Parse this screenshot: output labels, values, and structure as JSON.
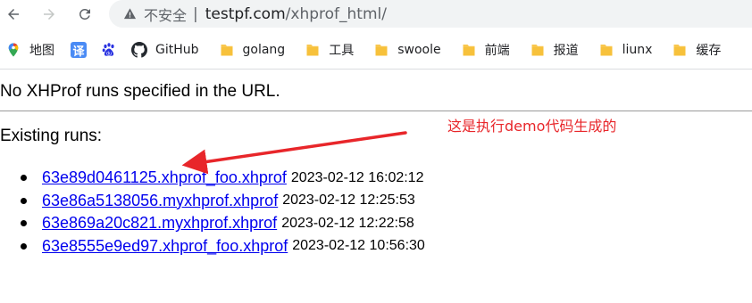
{
  "browser": {
    "security_label": "不安全",
    "separator": "|",
    "url_host": "testpf.com",
    "url_path": "/xhprof_html/"
  },
  "bookmarks": [
    {
      "label": "地图",
      "icon": "maps-icon"
    },
    {
      "label": "",
      "icon": "translate-icon",
      "glyph": "译"
    },
    {
      "label": "",
      "icon": "baidu-paw-icon"
    },
    {
      "label": "GitHub",
      "icon": "github-icon"
    },
    {
      "label": "golang",
      "icon": "folder-icon"
    },
    {
      "label": "工具",
      "icon": "folder-icon"
    },
    {
      "label": "swoole",
      "icon": "folder-icon"
    },
    {
      "label": "前端",
      "icon": "folder-icon"
    },
    {
      "label": "报道",
      "icon": "folder-icon"
    },
    {
      "label": "liunx",
      "icon": "folder-icon"
    },
    {
      "label": "缓存",
      "icon": "folder-icon"
    }
  ],
  "page": {
    "message": "No XHProf runs specified in the URL.",
    "existing_label": "Existing runs:",
    "runs": [
      {
        "file": "63e89d0461125.xhprof_foo.xhprof",
        "time": "2023-02-12 16:02:12"
      },
      {
        "file": "63e86a5138056.myxhprof.xhprof",
        "time": "2023-02-12 12:25:53"
      },
      {
        "file": "63e869a20c821.myxhprof.xhprof",
        "time": "2023-02-12 12:22:58"
      },
      {
        "file": "63e8555e9ed97.xhprof_foo.xhprof",
        "time": "2023-02-12 10:56:30"
      }
    ]
  },
  "annotation": {
    "text": "这是执行demo代码生成的",
    "color": "#e8262a"
  },
  "colors": {
    "link": "#0000ee",
    "folder": "#f9c74f",
    "omnibox_bg": "#f1f3f4"
  }
}
